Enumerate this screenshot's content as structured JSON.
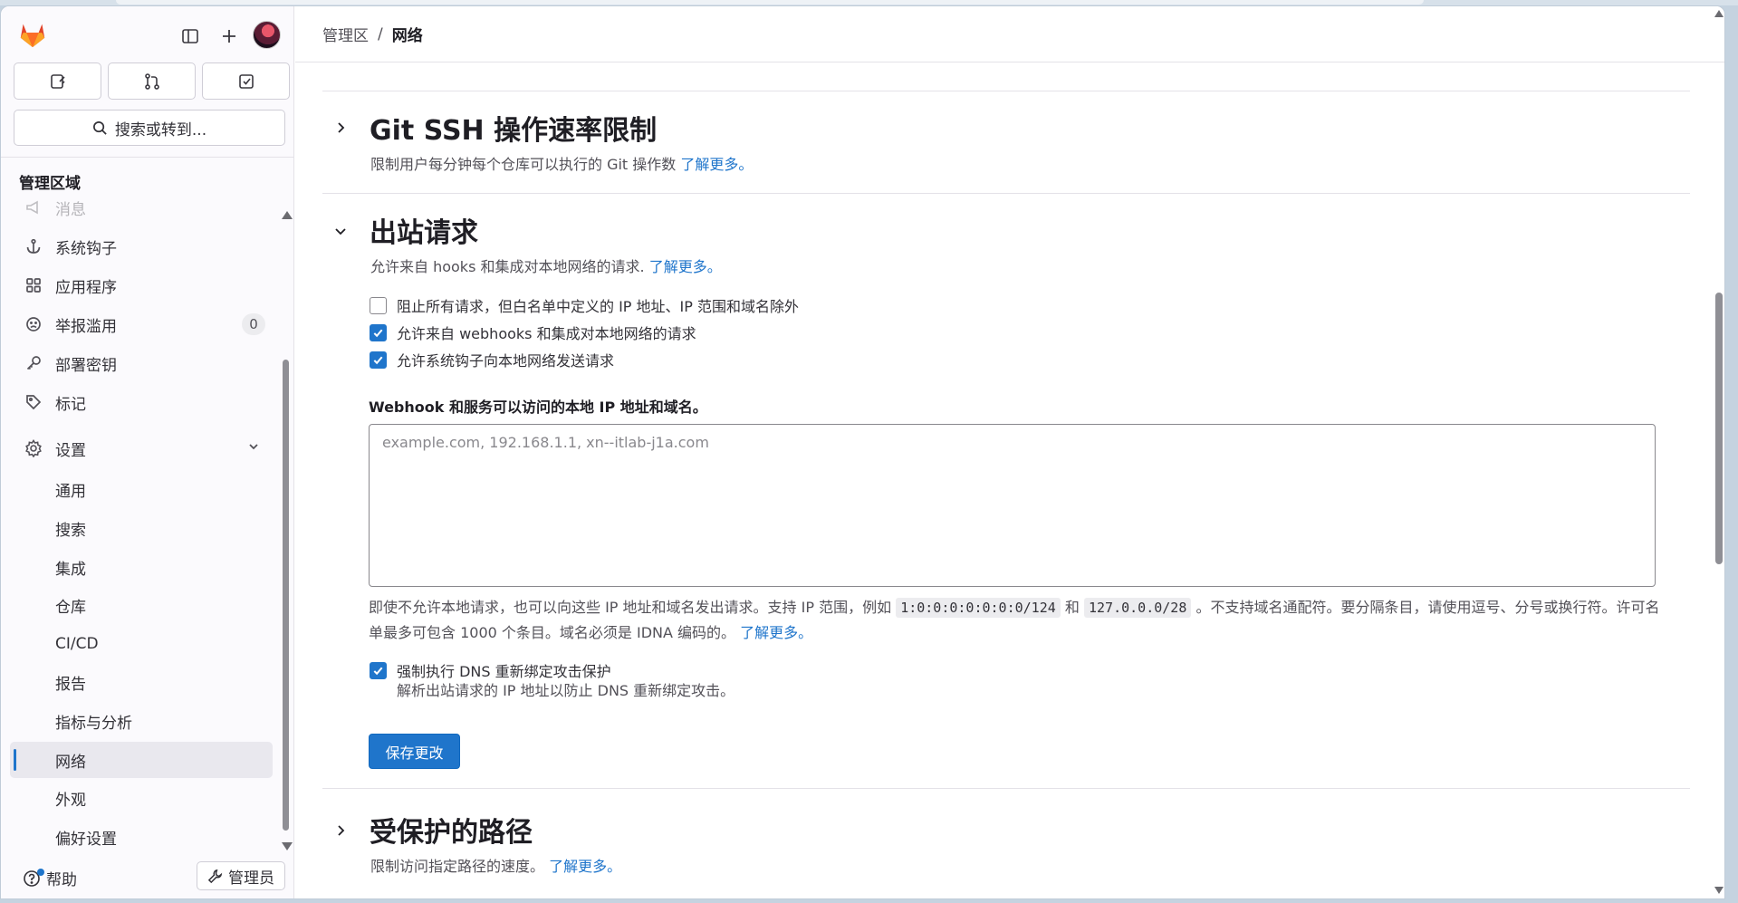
{
  "breadcrumb": {
    "items": [
      "管理区"
    ],
    "separator": "/",
    "current": "网络"
  },
  "sidebar": {
    "search_label": "搜索或转到...",
    "section_title": "管理区域",
    "items": [
      {
        "label": "消息",
        "icon": "bullhorn-icon"
      },
      {
        "label": "系统钩子",
        "icon": "anchor-icon"
      },
      {
        "label": "应用程序",
        "icon": "applications-icon"
      },
      {
        "label": "举报滥用",
        "icon": "abuse-icon",
        "count": "0"
      },
      {
        "label": "部署密钥",
        "icon": "key-icon"
      },
      {
        "label": "标记",
        "icon": "label-icon"
      },
      {
        "label": "设置",
        "icon": "settings-icon"
      }
    ],
    "sub_items": [
      "通用",
      "搜索",
      "集成",
      "仓库",
      "CI/CD",
      "报告",
      "指标与分析",
      "网络",
      "外观",
      "偏好设置"
    ],
    "active_sub": "网络",
    "help_label": "帮助",
    "admin_label": "管理员"
  },
  "sections": {
    "git_ssh": {
      "title": "Git SSH 操作速率限制",
      "description": "限制用户每分钟每个仓库可以执行的 Git 操作数",
      "link": "了解更多。"
    },
    "outbound": {
      "title": "出站请求",
      "description": "允许来自 hooks 和集成对本地网络的请求.",
      "link": "了解更多。",
      "checkboxes": [
        {
          "label": "阻止所有请求，但白名单中定义的 IP 地址、IP 范围和域名除外",
          "checked": false
        },
        {
          "label": "允许来自 webhooks 和集成对本地网络的请求",
          "checked": true
        },
        {
          "label": "允许系统钩子向本地网络发送请求",
          "checked": true
        }
      ],
      "field_label": "Webhook 和服务可以访问的本地 IP 地址和域名。",
      "field_placeholder": "example.com, 192.168.1.1, xn--itlab-j1a.com",
      "help_part1": "即使不允许本地请求，也可以向这些 IP 地址和域名发出请求。支持 IP 范围，例如",
      "code1": "1:0:0:0:0:0:0:0/124",
      "help_and": "和",
      "code2": "127.0.0.0/28",
      "help_part2": "。不支持域名通配符。要分隔条目，请使用逗号、分号或换行符。许可名单最多可包含 1000 个条目。域名必须是 IDNA 编码的。",
      "help_link": "了解更多。",
      "dns_label": "强制执行 DNS 重新绑定攻击保护",
      "dns_checked": true,
      "dns_help": "解析出站请求的 IP 地址以防止 DNS 重新绑定攻击。",
      "save_label": "保存更改"
    },
    "protected_paths": {
      "title": "受保护的路径",
      "description": "限制访问指定路径的速度。",
      "link": "了解更多。"
    }
  },
  "colors": {
    "accent": "#1f75cb",
    "logo_orange": "#fc6d26",
    "logo_red": "#e24329",
    "logo_amber": "#fca326"
  }
}
